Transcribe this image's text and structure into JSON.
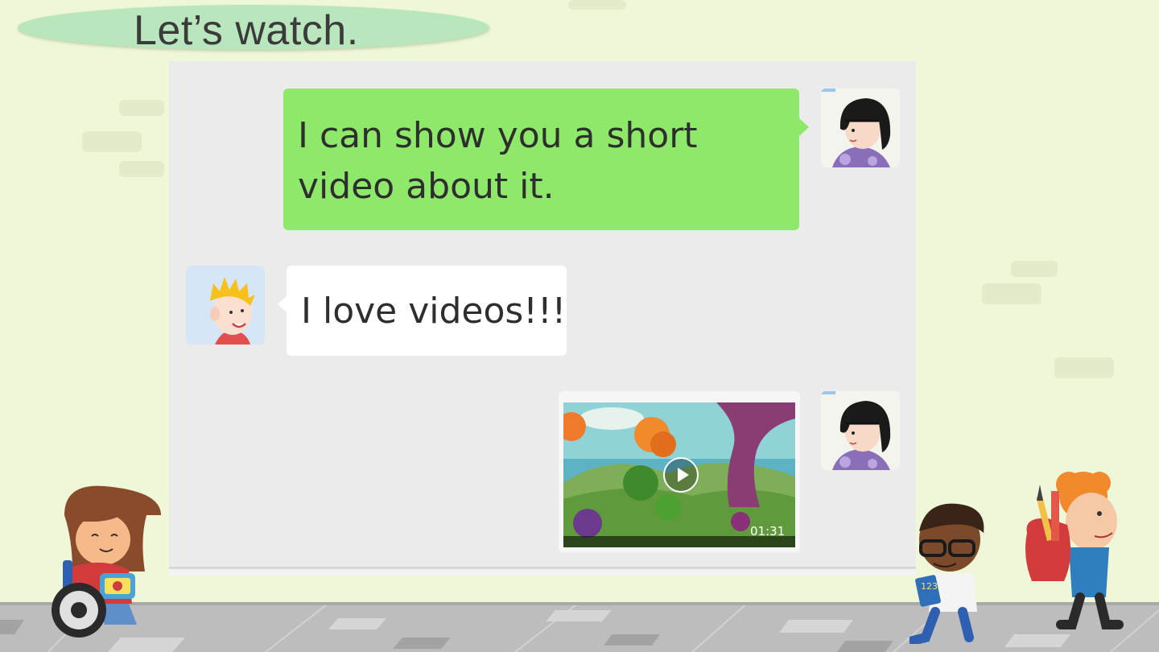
{
  "slide": {
    "title": "Let’s watch."
  },
  "chat": {
    "messages": [
      {
        "sender": "girl",
        "side": "right",
        "type": "text",
        "lines": [
          "I can show you a short",
          "video about it."
        ],
        "bubble_color": "#8ee96b"
      },
      {
        "sender": "boy",
        "side": "left",
        "type": "text",
        "lines": [
          "I love videos!!!"
        ],
        "bubble_color": "#ffffff"
      },
      {
        "sender": "girl",
        "side": "right",
        "type": "video",
        "duration": "01:31",
        "icon": "play-icon"
      }
    ],
    "panel_color": "#ebebeb"
  },
  "colors": {
    "background": "#eef7d8",
    "title_pill": "#b9e6bd",
    "title_text": "#3b3b3b"
  }
}
